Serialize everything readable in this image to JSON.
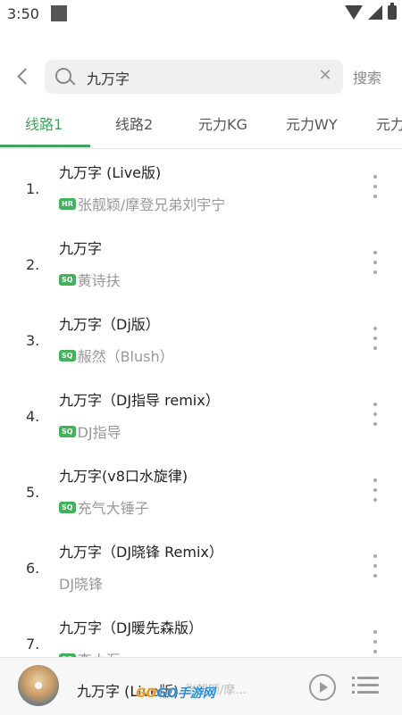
{
  "status": {
    "time": "3:50"
  },
  "search": {
    "query": "九万字",
    "action_label": "搜索"
  },
  "tabs": [
    {
      "label": "线路1",
      "active": true
    },
    {
      "label": "线路2",
      "active": false
    },
    {
      "label": "元力KG",
      "active": false
    },
    {
      "label": "元力WY",
      "active": false
    },
    {
      "label": "元力",
      "active": false
    }
  ],
  "songs": [
    {
      "index": "1.",
      "title": "九万字 (Live版)",
      "badge": "HR",
      "artist": "张靓颖/摩登兄弟刘宇宁"
    },
    {
      "index": "2.",
      "title": "九万字",
      "badge": "SQ",
      "artist": "黄诗扶"
    },
    {
      "index": "3.",
      "title": "九万字（Dj版）",
      "badge": "SQ",
      "artist": "赧然（Blush）"
    },
    {
      "index": "4.",
      "title": "九万字（DJ指导 remix）",
      "badge": "SQ",
      "artist": "DJ指导"
    },
    {
      "index": "5.",
      "title": "九万字(v8口水旋律)",
      "badge": "SQ",
      "artist": "充气大锤子"
    },
    {
      "index": "6.",
      "title": "九万字（DJ晓锋 Remix）",
      "badge": "",
      "artist": "DJ晓锋"
    },
    {
      "index": "7.",
      "title": "九万字（DJ暖先森版）",
      "badge": "SQ",
      "artist": "李小汇"
    }
  ],
  "player": {
    "title": "九万字 (Live版)",
    "artist": "张靓颖/摩..."
  },
  "watermark": {
    "prefix": "GO",
    "main": "GO手游网"
  },
  "colors": {
    "accent": "#3fa55d",
    "badge": "#3fb25a"
  }
}
